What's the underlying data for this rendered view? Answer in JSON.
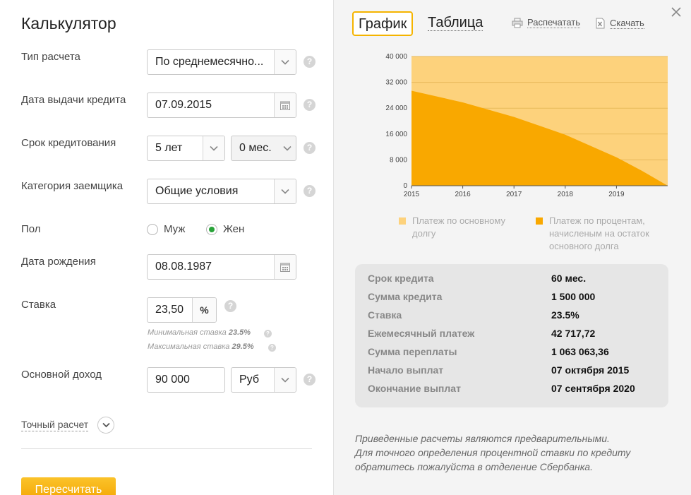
{
  "left": {
    "title": "Калькулятор",
    "calc_type": {
      "label": "Тип расчета",
      "value": "По среднемесячно..."
    },
    "issue_date": {
      "label": "Дата выдачи кредита",
      "value": "07.09.2015"
    },
    "term": {
      "label": "Срок кредитования",
      "years": "5 лет",
      "months": "0 мес."
    },
    "category": {
      "label": "Категория заемщика",
      "value": "Общие условия"
    },
    "gender": {
      "label": "Пол",
      "male": "Муж",
      "female": "Жен",
      "selected": "female"
    },
    "birth_date": {
      "label": "Дата рождения",
      "value": "08.08.1987"
    },
    "rate": {
      "label": "Ставка",
      "value": "23,50",
      "unit": "%",
      "min_label": "Минимальная ставка",
      "min_value": "23.5%",
      "max_label": "Максимальная ставка",
      "max_value": "29.5%"
    },
    "income": {
      "label": "Основной доход",
      "value": "90 000",
      "currency": "Руб"
    },
    "exact_label": "Точный расчет",
    "recalc_label": "Пересчитать",
    "help_glyph": "?"
  },
  "right": {
    "tabs": {
      "chart": "График",
      "table": "Таблица"
    },
    "print_label": "Распечатать",
    "download_label": "Скачать",
    "legend": {
      "principal": "Платеж по основному долгу",
      "interest": "Платеж по процентам, начисленым на остаток основного долга"
    },
    "summary": [
      {
        "k": "Срок кредита",
        "v": "60 мес."
      },
      {
        "k": "Сумма кредита",
        "v": "1 500 000"
      },
      {
        "k": "Ставка",
        "v": "23.5%"
      },
      {
        "k": "Ежемесячный платеж",
        "v": "42 717,72"
      },
      {
        "k": "Сумма переплаты",
        "v": "1 063 063,36"
      },
      {
        "k": "Начало выплат",
        "v": "07 октября 2015"
      },
      {
        "k": "Окончание выплат",
        "v": "07 сентября 2020"
      }
    ],
    "note": [
      "Приведенные расчеты являются предварительными.",
      "Для точного определения процентной ставки по кредиту",
      "обратитесь пожалуйста в отделение Сбербанка."
    ]
  },
  "colors": {
    "principal": "#fdd27c",
    "interest": "#f9a800",
    "accent": "#f5b400",
    "radio_on": "#29a339"
  },
  "chart_data": {
    "type": "area",
    "y_ticks": [
      "40 000",
      "32 000",
      "24 000",
      "16 000",
      "8 000",
      "0"
    ],
    "x_ticks": [
      "2015",
      "2016",
      "2017",
      "2018",
      "2019"
    ],
    "ylim": [
      0,
      40000
    ],
    "xlim": [
      2015,
      2020
    ],
    "series": [
      {
        "name": "Платеж по основному долгу",
        "x": [
          2015,
          2020
        ],
        "y": [
          42717,
          42717
        ]
      },
      {
        "name": "Платеж по процентам, начисленым на остаток основного долга",
        "x": [
          2015,
          2016,
          2017,
          2018,
          2019,
          2019.5,
          2020
        ],
        "y": [
          29400,
          25800,
          21300,
          15800,
          8800,
          4600,
          0
        ]
      }
    ]
  }
}
